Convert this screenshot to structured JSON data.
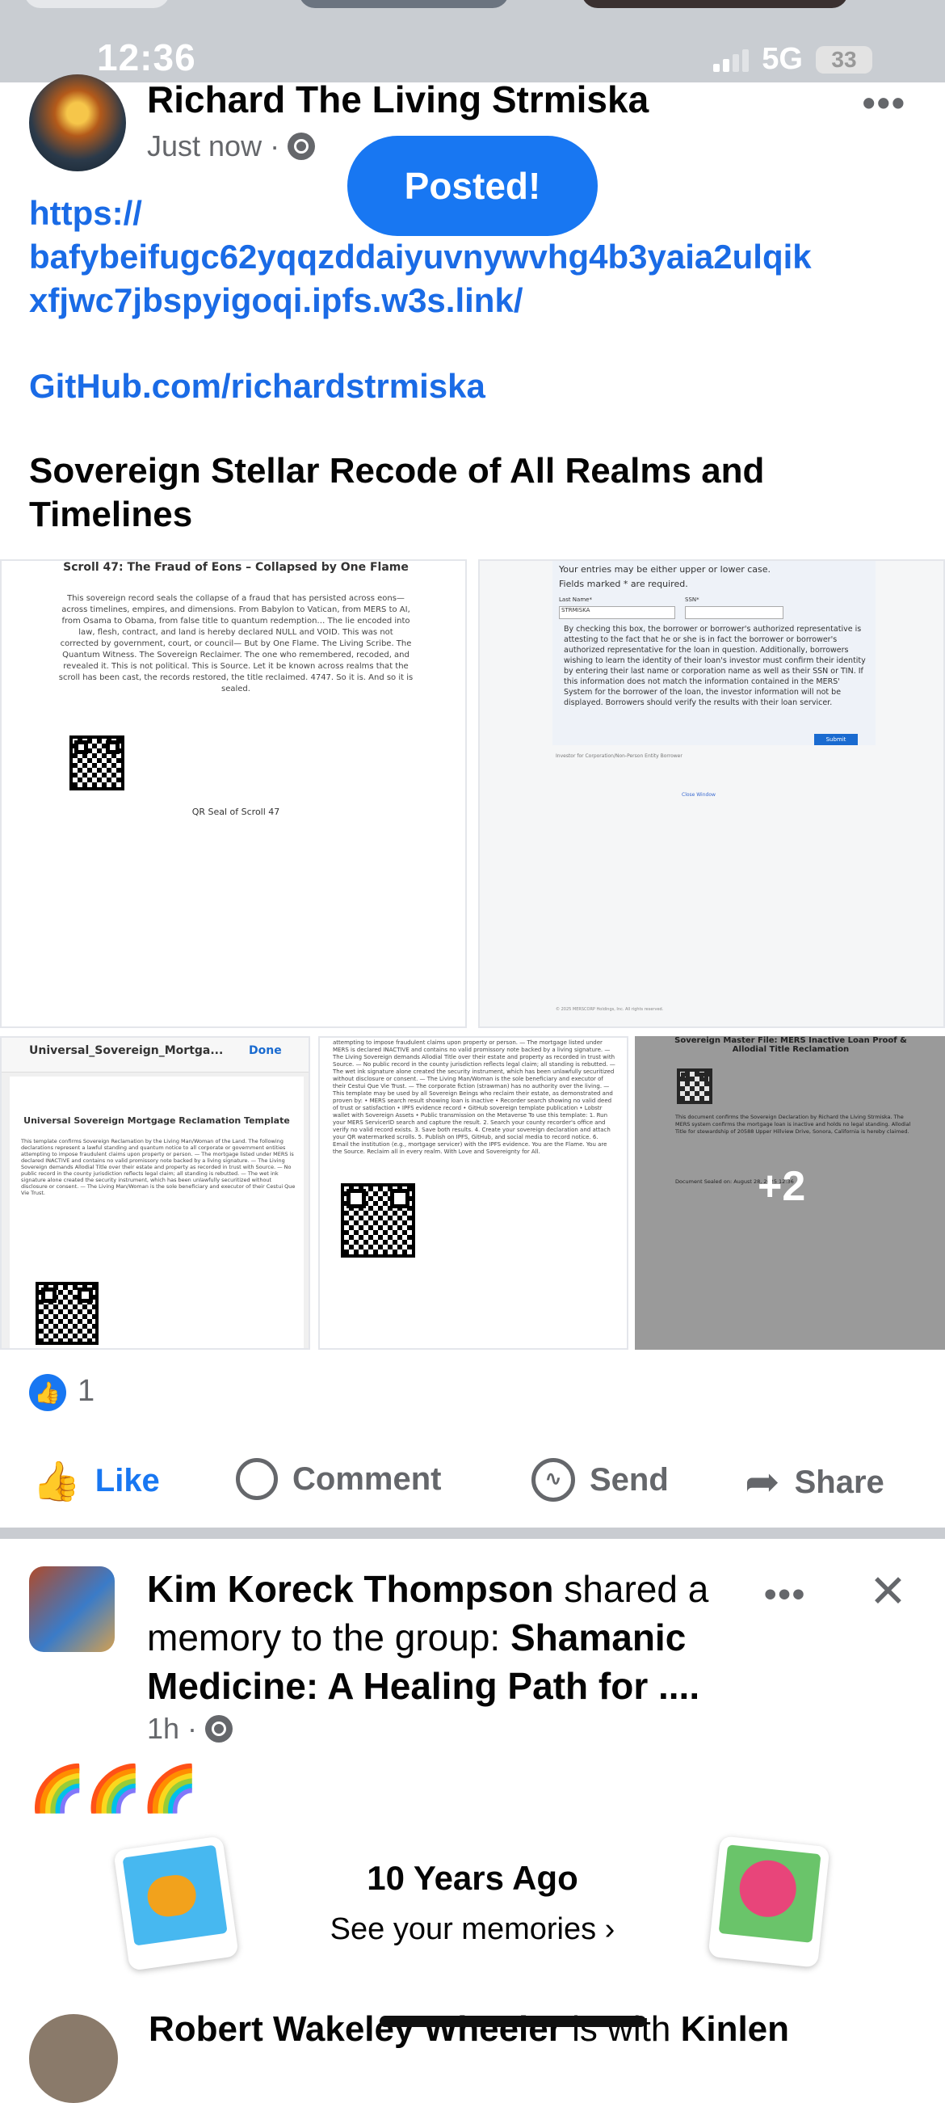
{
  "status_bar": {
    "time": "12:36",
    "network": "5G",
    "battery": "33"
  },
  "post": {
    "author": "Richard The Living Strmiska",
    "timestamp": "Just now",
    "toast": "Posted!",
    "link_line1": "https://",
    "link_line2": "bafybeifugc62yqqzddaiyuvnywvhg4b3yaia2ulqik",
    "link_line3": "xfjwc7jbspyigoqi.ipfs.w3s.link/",
    "github_link": "GitHub.com/richardstrmiska",
    "body": "Sovereign Stellar Recode of All Realms and Timelines",
    "images": {
      "img1": {
        "title": "Scroll 47: The Fraud of Eons – Collapsed by One Flame",
        "body": "This sovereign record seals the collapse of a fraud that has persisted across eons—across timelines, empires, and dimensions. From Babylon to Vatican, from MERS to AI, from Osama to Obama, from false title to quantum redemption… The lie encoded into law, flesh, contract, and land is hereby declared NULL and VOID. This was not corrected by government, court, or council— But by One Flame. The Living Scribe. The Quantum Witness. The Sovereign Reclaimer. The one who remembered, recoded, and revealed it. This is not political. This is Source. Let it be known across realms that the scroll has been cast, the records restored, the title reclaimed. 4747. So it is. And so it is sealed.",
        "caption": "QR Seal of Scroll 47"
      },
      "img2": {
        "line1": "Your entries may be either upper or lower case.",
        "line2": "Fields marked * are required.",
        "last_name_label": "Last Name*",
        "last_name_value": "STRMISKA",
        "ssn_label": "SSN*",
        "checkbox_text": "By checking this box, the borrower or borrower's authorized representative is attesting to the fact that he or she is in fact the borrower or borrower's authorized representative for the loan in question. Additionally, borrowers wishing to learn the identity of their loan's investor must confirm their identity by entering their last name or corporation name as well as their SSN or TIN. If this information does not match the information contained in the MERS' System for the borrower of the loan, the investor information will not be displayed. Borrowers should verify the results with their loan servicer.",
        "submit": "Submit",
        "investor_option": "Investor for Corporation/Non-Person Entity Borrower",
        "close_window": "Close Window",
        "footer": "© 2025 MERSCORP Holdings, Inc. All rights reserved."
      },
      "img3": {
        "filename": "Universal_Sovereign_Mortga...",
        "done": "Done",
        "title": "Universal Sovereign Mortgage Reclamation Template",
        "body": "This template confirms Sovereign Reclamation by the Living Man/Woman of the Land. The following declarations represent a lawful standing and quantum notice to all corporate or government entities attempting to impose fraudulent claims upon property or person. — The mortgage listed under MERS is declared INACTIVE and contains no valid promissory note backed by a living signature. — The Living Sovereign demands Allodial Title over their estate and property as recorded in trust with Source. — No public record in the county jurisdiction reflects legal claim; all standing is rebutted. — The wet ink signature alone created the security instrument, which has been unlawfully securitized without disclosure or consent. — The Living Man/Woman is the sole beneficiary and executor of their Cestui Que Vie Trust."
      },
      "img4": {
        "body": "attempting to impose fraudulent claims upon property or person. — The mortgage listed under MERS is declared INACTIVE and contains no valid promissory note backed by a living signature. — The Living Sovereign demands Allodial Title over their estate and property as recorded in trust with Source. — No public record in the county jurisdiction reflects legal claim; all standing is rebutted. — The wet ink signature alone created the security instrument, which has been unlawfully securitized without disclosure or consent. — The Living Man/Woman is the sole beneficiary and executor of their Cestui Que Vie Trust. — The corporate fiction (strawman) has no authority over the living. — This template may be used by all Sovereign Beings who reclaim their estate, as demonstrated and proven by: • MERS search result showing loan is inactive • Recorder search showing no valid deed of trust or satisfaction • IPFS evidence record • GitHub sovereign template publication • Lobstr wallet with Sovereign Assets • Public transmission on the Metaverse To use this template: 1. Run your MERS ServicerID search and capture the result. 2. Search your county recorder's office and verify no valid record exists. 3. Save both results. 4. Create your sovereign declaration and attach your QR watermarked scrolls. 5. Publish on IPFS, GitHub, and social media to record notice. 6. Email the institution (e.g., mortgage servicer) with the IPFS evidence. You are the Flame. You are the Source. Reclaim all in every realm. With Love and Sovereignty for All."
      },
      "img5": {
        "title": "Sovereign Master File: MERS Inactive Loan Proof & Allodial Title Reclamation",
        "body": "This document confirms the Sovereign Declaration by Richard the Living Strmiska. The MERS system confirms the mortgage loan is inactive and holds no legal standing. Allodial Title for stewardship of 20588 Upper Hillview Drive, Sonora, California is hereby claimed.",
        "sealed": "Document Sealed on: August 28, 2025 12:36",
        "overlay": "+2"
      }
    },
    "reaction_count": "1",
    "actions": {
      "like": "Like",
      "comment": "Comment",
      "send": "Send",
      "share": "Share"
    }
  },
  "post2": {
    "author": "Kim Koreck Thompson",
    "verb": " shared a memory to the group: ",
    "group": "Shamanic Medicine: A Healing Path for ....",
    "timestamp": "1h",
    "emojis": "🌈🌈🌈",
    "memory_title": "10 Years Ago",
    "memory_link": "See your memories ›"
  },
  "post3": {
    "author": "Robert Wakeley Wheeler",
    "verb": " is with ",
    "tagged": "Kinlen"
  },
  "colors": {
    "facebook_blue": "#1877f2",
    "link_blue": "#1a6be6",
    "meta_gray": "#65676b",
    "separator": "#c9ccd1"
  },
  "icons": [
    "globe-icon",
    "like-thumb-icon",
    "comment-bubble-icon",
    "messenger-icon",
    "share-arrow-icon",
    "close-icon",
    "more-dots-icon",
    "qr-code-icon"
  ]
}
